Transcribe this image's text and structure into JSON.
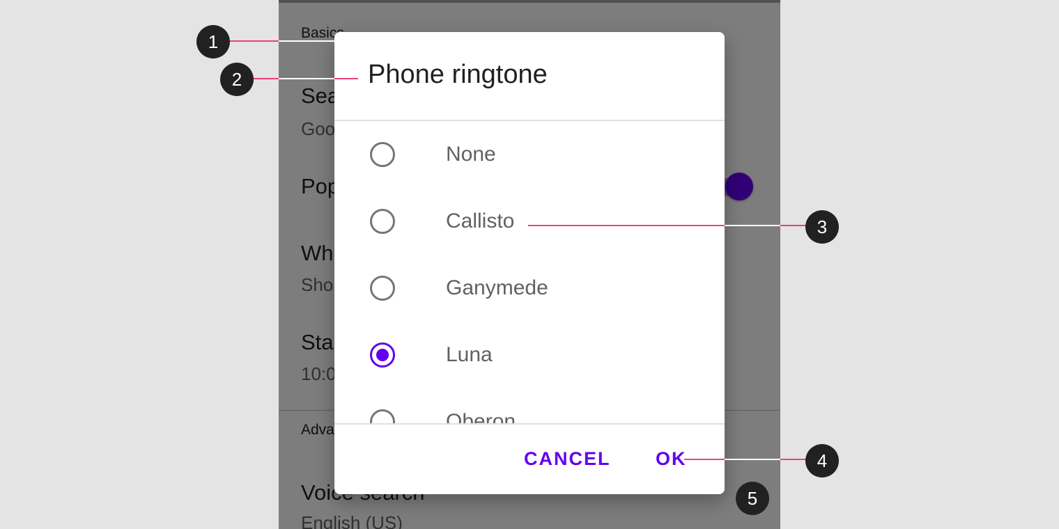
{
  "background_screen": {
    "section_basics": "Basics",
    "search_label": "Sea",
    "search_value": "Goo",
    "popup_label": "Pop",
    "wh_label": "Wh",
    "wh_value": "Sho",
    "start_label": "Sta",
    "start_value": "10:0",
    "section_advanced": "Adva",
    "voice_label": "Voice search",
    "voice_value": "English (US)",
    "toggle_on": true
  },
  "dialog": {
    "title": "Phone ringtone",
    "options": [
      {
        "label": "None",
        "selected": false
      },
      {
        "label": "Callisto",
        "selected": false
      },
      {
        "label": "Ganymede",
        "selected": false
      },
      {
        "label": "Luna",
        "selected": true
      },
      {
        "label": "Oberon",
        "selected": false
      }
    ],
    "cancel_label": "CANCEL",
    "ok_label": "OK"
  },
  "callouts": [
    "1",
    "2",
    "3",
    "4",
    "5"
  ],
  "colors": {
    "accent": "#6200ee",
    "callout_bg": "#212121",
    "leader_line": "#ec407a",
    "page_bg": "#e4e4e4"
  }
}
